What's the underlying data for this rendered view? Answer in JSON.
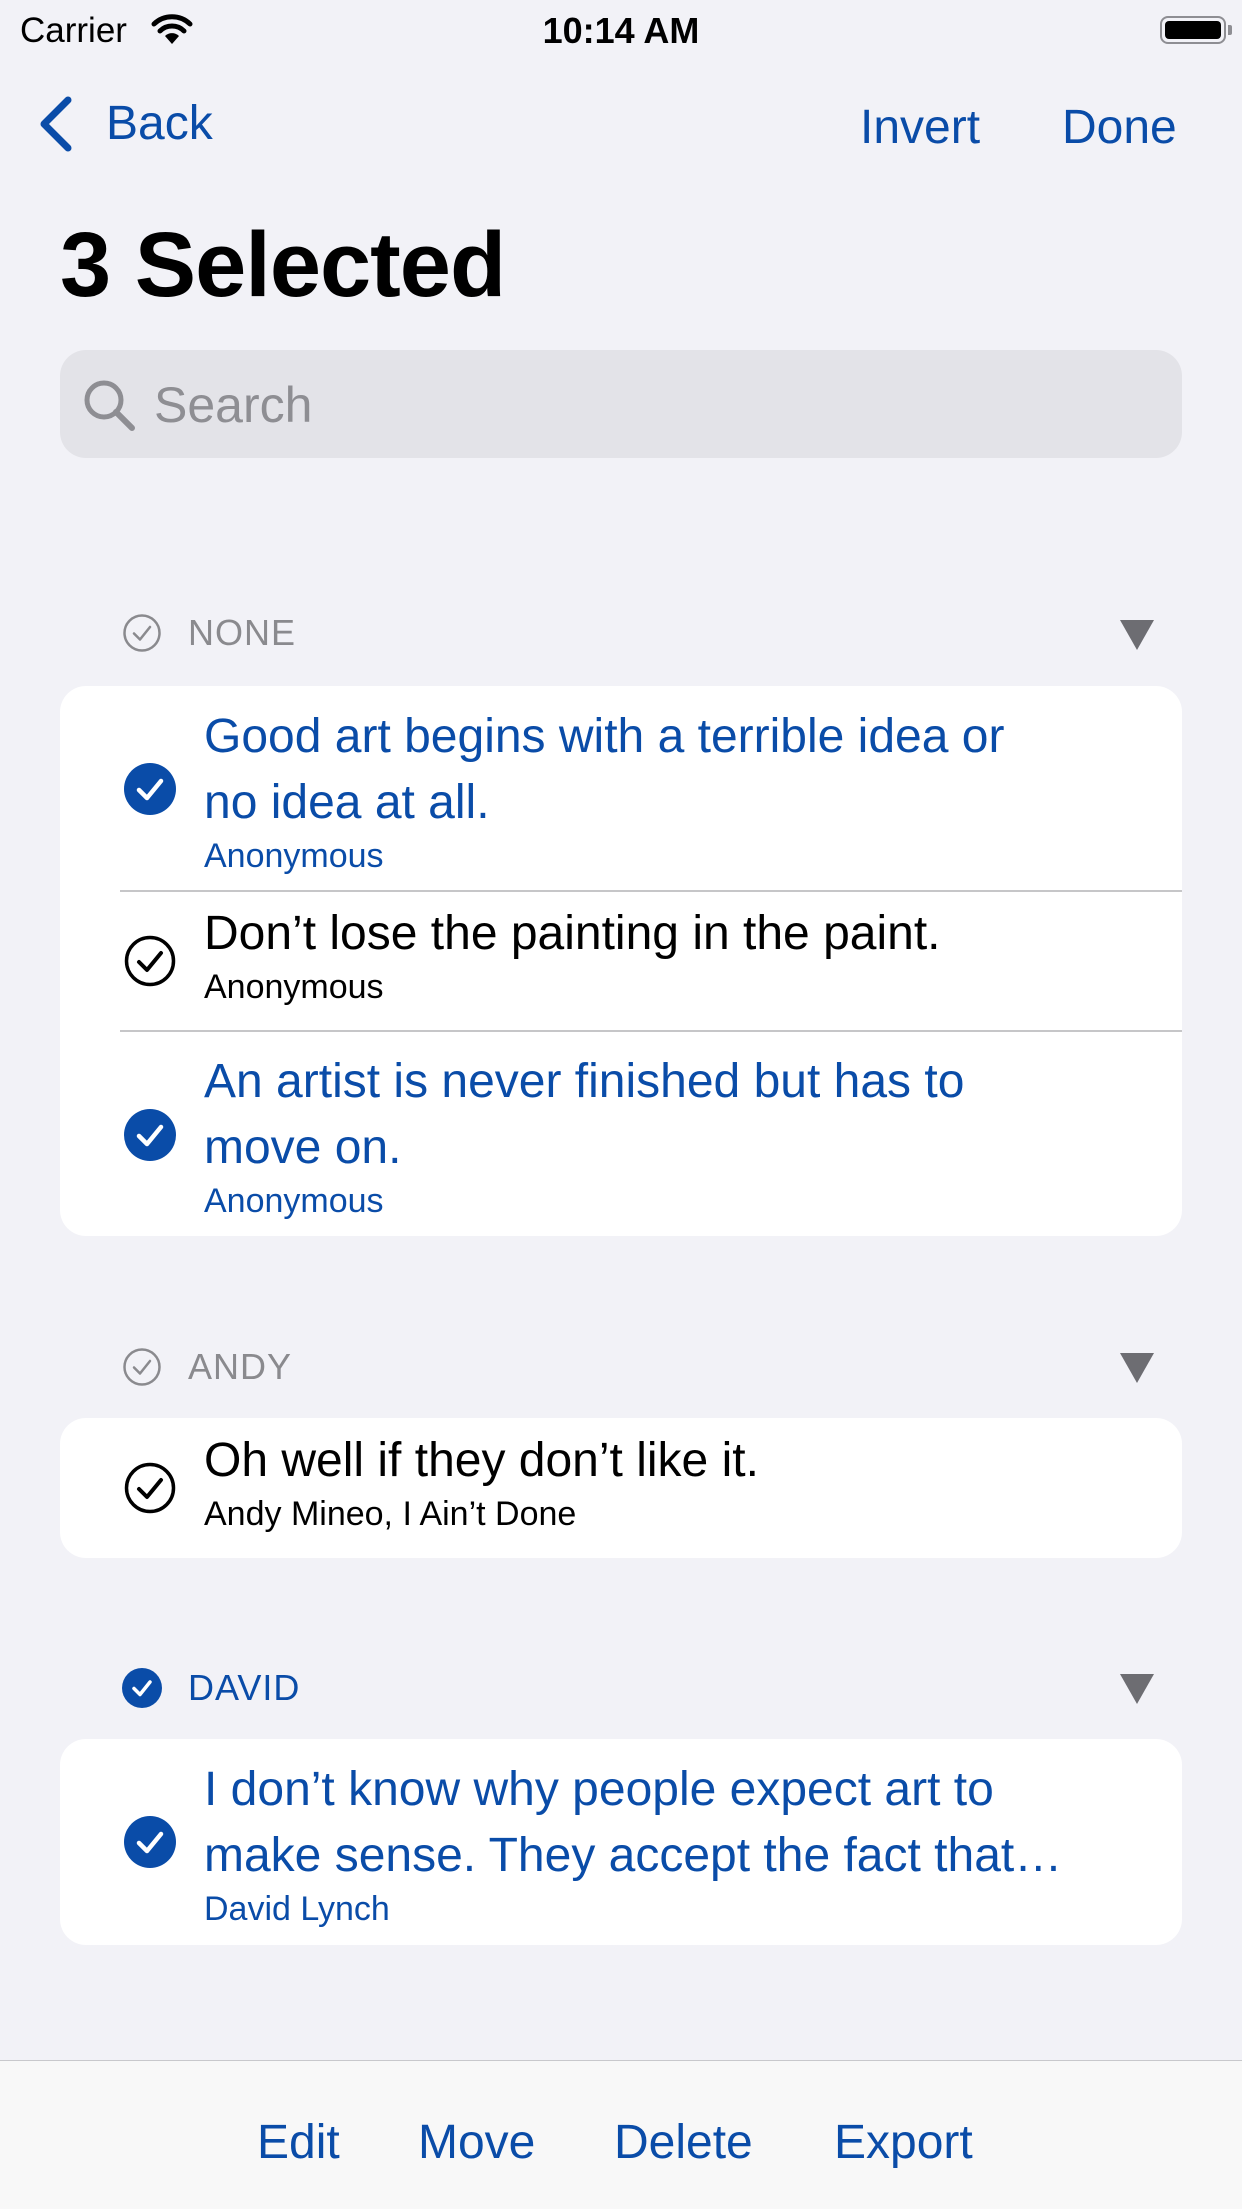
{
  "status": {
    "carrier": "Carrier",
    "time": "10:14 AM"
  },
  "nav": {
    "back": "Back",
    "invert": "Invert",
    "done": "Done"
  },
  "title": "3 Selected",
  "search": {
    "placeholder": "Search",
    "value": ""
  },
  "sections": [
    {
      "label": "NONE",
      "selected": false,
      "rows": [
        {
          "quote_line1": "Good art begins with a terrible idea or",
          "quote_line2": "no idea at all.",
          "author": "Anonymous",
          "selected": true
        },
        {
          "quote_line1": "Don’t lose the painting in the paint.",
          "author": "Anonymous",
          "selected": false
        },
        {
          "quote_line1": "An artist is never finished but has to",
          "quote_line2": "move on.",
          "author": "Anonymous",
          "selected": true
        }
      ]
    },
    {
      "label": "ANDY",
      "selected": false,
      "rows": [
        {
          "quote_line1": "Oh well if they don’t like it.",
          "author": "Andy Mineo, I Ain’t Done",
          "selected": false
        }
      ]
    },
    {
      "label": "DAVID",
      "selected": true,
      "rows": [
        {
          "quote_line1": "I don’t know why people expect art to",
          "quote_line2": "make sense. They accept the fact that…",
          "author": "David Lynch",
          "selected": true
        }
      ]
    }
  ],
  "toolbar": {
    "edit": "Edit",
    "move": "Move",
    "delete": "Delete",
    "export": "Export"
  },
  "colors": {
    "accent": "#0a4ca8",
    "background": "#f2f2f7",
    "card": "#ffffff"
  }
}
